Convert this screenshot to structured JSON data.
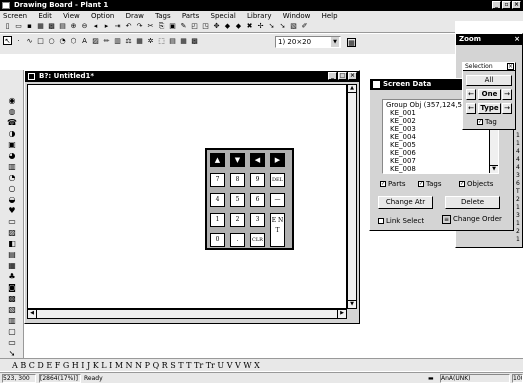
{
  "app": {
    "title": "Drawing Board - Plant 1"
  },
  "menu": [
    "Screen",
    "Edit",
    "View",
    "Option",
    "Draw",
    "Tags",
    "Parts",
    "Special",
    "Library",
    "Window",
    "Help"
  ],
  "toolbar": {
    "grid_value": "1) 20×20"
  },
  "zoom": {
    "title": "Zoom"
  },
  "doc": {
    "title": "B?: Untitled1*"
  },
  "keypad": {
    "arrows": [
      "▲",
      "▼",
      "◀",
      "▶"
    ],
    "rows": [
      [
        "7",
        "8",
        "9",
        "DEL"
      ],
      [
        "4",
        "5",
        "6",
        "—"
      ],
      [
        "1",
        "2",
        "3"
      ],
      [
        "0",
        ".",
        "CLR"
      ]
    ],
    "enter": "E N T"
  },
  "screen_data": {
    "title": "Screen Data",
    "group": "Group Obj (357,124,517,3",
    "items": [
      "KE_001",
      "KE_002",
      "KE_003",
      "KE_004",
      "KE_005",
      "KE_006",
      "KE_007",
      "KE_008"
    ],
    "checks": {
      "parts": "Parts",
      "tags": "Tags",
      "objects": "Objects"
    },
    "change_attr": "Change Atr",
    "delete": "Delete",
    "link_select": "Link Select",
    "change_order": "Change Order"
  },
  "selection": {
    "title": "Selection",
    "all": "All",
    "one": "One",
    "type": "Type",
    "tag": "Tag"
  },
  "right_strip": [
    "1",
    "1",
    "4",
    "4",
    "4",
    "3",
    "6",
    "T",
    "2",
    "1",
    "3",
    "1",
    "2",
    "1"
  ],
  "alphabet": "A B C D E F G H I J K L I M N N P Q R S T T Tr Tr U V V W X",
  "status": {
    "coords": "523, 300",
    "mem": "[2864(17%)]",
    "state": "Ready",
    "mode": "AnA(UNK)",
    "right": "100"
  },
  "colors": {
    "titlebar": "#000000",
    "face": "#d4d4d4"
  }
}
